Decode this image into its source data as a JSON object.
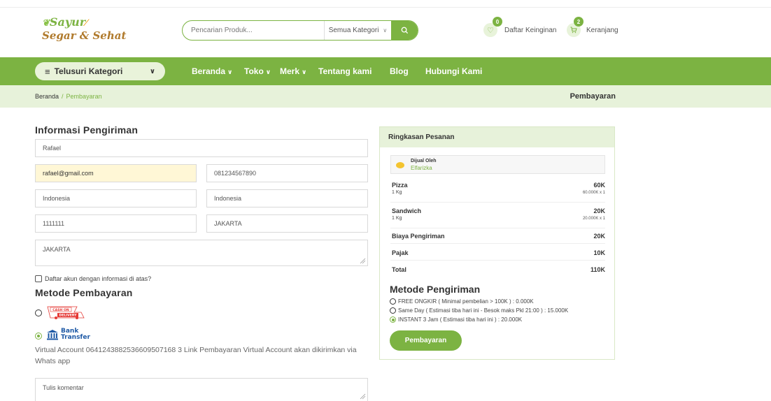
{
  "header": {
    "logo_line1": "Sayur",
    "logo_line2": "Segar & Sehat",
    "search_placeholder": "Pencarian Produk...",
    "category_select": "Semua Kategori",
    "wishlist_label": "Daftar Keinginan",
    "wishlist_count": "0",
    "cart_label": "Keranjang",
    "cart_count": "2"
  },
  "nav": {
    "browse_label": "Telusuri Kategori",
    "items": [
      "Beranda",
      "Toko",
      "Merk",
      "Tentang kami",
      "Blog",
      "Hubungi Kami"
    ]
  },
  "breadcrumb": {
    "home": "Beranda",
    "separator": "/",
    "current": "Pembayaran",
    "page_title": "Pembayaran"
  },
  "shipping_info": {
    "title": "Informasi Pengiriman",
    "name": "Rafael",
    "email": "rafael@gmail.com",
    "phone": "081234567890",
    "country": "Indonesia",
    "province": "Indonesia",
    "postal_code": "1111111",
    "city": "JAKARTA",
    "address": "JAKARTA",
    "register_checkbox_label": "Daftar akun dengan informasi di atas?"
  },
  "payment_method": {
    "title": "Metode Pembayaran",
    "cod_line1": "CASH ON",
    "cod_line2": "DELIVERY",
    "bank_line1": "Bank",
    "bank_line2": "Transfer",
    "selected": "bank_transfer",
    "virtual_account_text": "Virtual Account 0641243882536609507168 3 Link Pembayaran Virtual Account akan dikirimkan via Whats app",
    "comment_placeholder": "Tulis komentar"
  },
  "summary": {
    "title": "Ringkasan Pesanan",
    "seller_by": "Dijual Oleh",
    "seller_name": "Elfarizka",
    "items": [
      {
        "name": "Pizza",
        "unit": "1 Kg",
        "amount": "60K",
        "qty": "60.000K x 1"
      },
      {
        "name": "Sandwich",
        "unit": "1 Kg",
        "amount": "20K",
        "qty": "20.000K x 1"
      }
    ],
    "shipping_label": "Biaya Pengiriman",
    "shipping_amount": "20K",
    "tax_label": "Pajak",
    "tax_amount": "10K",
    "total_label": "Total",
    "total_amount": "110K"
  },
  "delivery": {
    "title": "Metode Pengiriman",
    "options": [
      "FREE ONGKIR ( Minimal pembelian > 100K ) : 0.000K",
      "Same Day ( Estimasi tiba hari ini - Besok maks Pkl 21:00 ) : 15.000K",
      "INSTANT 3 Jam ( Estimasi tiba hari ini ) : 20.000K"
    ],
    "selected_index": 2,
    "pay_button": "Pembayaran"
  },
  "colors": {
    "primary": "#7cb342",
    "light": "#e7f2da",
    "highlight": "#fff7d6"
  }
}
